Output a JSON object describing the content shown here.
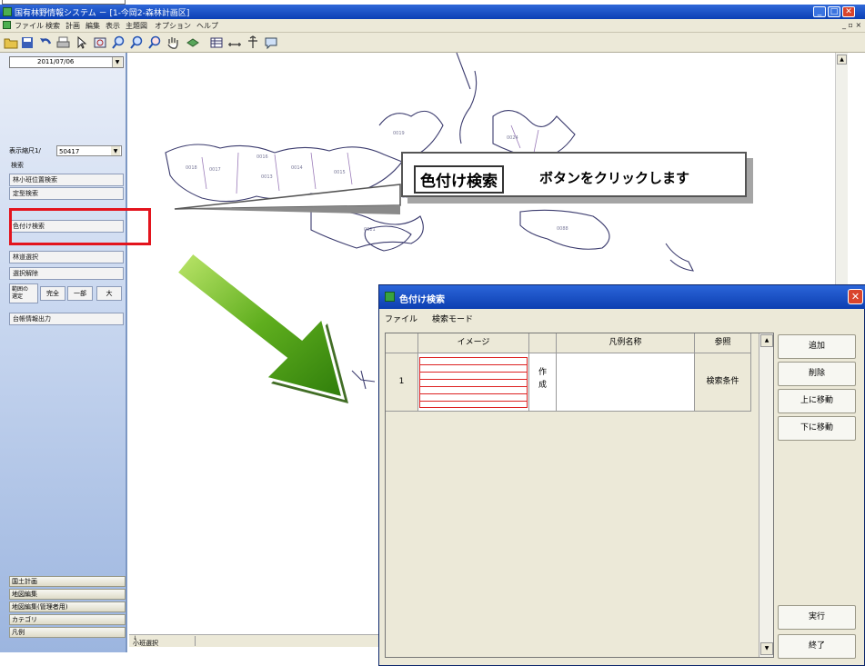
{
  "window": {
    "title": "国有林野情報システム － [1-今岡2-森林計画区]",
    "minimize": "_",
    "maximize": "□",
    "close": "✕"
  },
  "menu": [
    "ファイル",
    "検索",
    "計画",
    "編集",
    "表示",
    "主題図",
    "オプション",
    "ヘルプ"
  ],
  "toolbar_icons": [
    "open-folder-icon",
    "save-icon",
    "undo-icon",
    "print-icon",
    "select-icon",
    "zoom-area-icon",
    "zoom-in-icon",
    "zoom-out-icon",
    "zoom-extent-icon",
    "pan-hand-icon",
    "layer-icon",
    "table-icon",
    "measure-icon",
    "north-arrow-icon",
    "comment-icon"
  ],
  "left_panel": {
    "date": "2011/07/06",
    "scale_label": "表示縮尺1/",
    "scale_value": "50417",
    "search_header": "検索",
    "search_items": [
      "林小班位置検索",
      "定型検索"
    ],
    "color_search": "色付け検索",
    "forest_select": "林道選択",
    "deselect": "選択解除",
    "range_label": "範囲の\n選定",
    "range_full": "完全",
    "range_part": "一部",
    "range_other": "大",
    "ledger_output": "台帳情報出力",
    "footer_items": [
      "国土計画",
      "地図編集",
      "地図編集(管理者用)",
      "カテゴリ",
      "凡例"
    ]
  },
  "status": {
    "mode": "小班選択"
  },
  "callout": {
    "button_name": "色付け検索",
    "text": "ボタンをクリックします"
  },
  "map_labels": [
    "0021",
    "0018",
    "0017",
    "0014",
    "0015",
    "0013",
    "0016",
    "0019",
    "0024",
    "0022",
    "0023",
    "0088",
    "0025",
    "0031"
  ],
  "dialog": {
    "title": "色付け検索",
    "close": "✕",
    "menu": [
      "ファイル",
      "検索モード"
    ],
    "columns": [
      "イメージ",
      "凡例名称",
      "参照"
    ],
    "rows": [
      {
        "no": "1",
        "create": "作\n成",
        "legend_name": "",
        "reference": "検索条件"
      }
    ],
    "buttons": [
      "追加",
      "削除",
      "上に移動",
      "下に移動"
    ],
    "run": "実行",
    "finish": "終了"
  }
}
